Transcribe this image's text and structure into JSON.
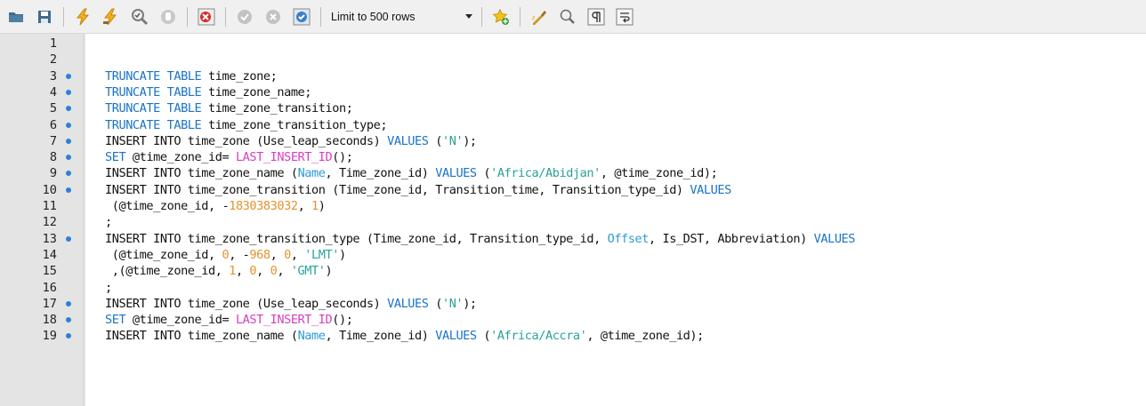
{
  "toolbar": {
    "limit_label": "Limit to 500 rows",
    "buttons": [
      {
        "name": "open-folder-icon"
      },
      {
        "name": "save-icon"
      },
      {
        "name": "execute-icon"
      },
      {
        "name": "execute-current-icon"
      },
      {
        "name": "explain-icon"
      },
      {
        "name": "stop-icon"
      },
      {
        "name": "toggle-error-icon"
      },
      {
        "name": "commit-icon"
      },
      {
        "name": "rollback-icon"
      },
      {
        "name": "autocommit-icon"
      },
      {
        "name": "add-snippet-icon"
      },
      {
        "name": "beautify-icon"
      },
      {
        "name": "find-icon"
      },
      {
        "name": "invisible-chars-icon"
      },
      {
        "name": "wrap-icon"
      }
    ]
  },
  "editor": {
    "lines": [
      {
        "n": "1",
        "dot": false,
        "tokens": []
      },
      {
        "n": "2",
        "dot": false,
        "tokens": []
      },
      {
        "n": "3",
        "dot": true,
        "tokens": [
          [
            "kw",
            "TRUNCATE TABLE"
          ],
          [
            "t",
            " time_zone;"
          ]
        ]
      },
      {
        "n": "4",
        "dot": true,
        "tokens": [
          [
            "kw",
            "TRUNCATE TABLE"
          ],
          [
            "t",
            " time_zone_name;"
          ]
        ]
      },
      {
        "n": "5",
        "dot": true,
        "tokens": [
          [
            "kw",
            "TRUNCATE TABLE"
          ],
          [
            "t",
            " time_zone_transition;"
          ]
        ]
      },
      {
        "n": "6",
        "dot": true,
        "tokens": [
          [
            "kw",
            "TRUNCATE TABLE"
          ],
          [
            "t",
            " time_zone_transition_type;"
          ]
        ]
      },
      {
        "n": "7",
        "dot": true,
        "tokens": [
          [
            "t",
            "INSERT INTO time_zone (Use_leap_seconds) "
          ],
          [
            "kw",
            "VALUES"
          ],
          [
            "t",
            " ("
          ],
          [
            "str",
            "'N'"
          ],
          [
            "t",
            ");"
          ]
        ]
      },
      {
        "n": "8",
        "dot": true,
        "tokens": [
          [
            "kw",
            "SET"
          ],
          [
            "t",
            " @time_zone_id= "
          ],
          [
            "fn",
            "LAST_INSERT_ID"
          ],
          [
            "t",
            "();"
          ]
        ]
      },
      {
        "n": "9",
        "dot": true,
        "tokens": [
          [
            "t",
            "INSERT INTO time_zone_name ("
          ],
          [
            "col",
            "Name"
          ],
          [
            "t",
            ", Time_zone_id) "
          ],
          [
            "kw",
            "VALUES"
          ],
          [
            "t",
            " ("
          ],
          [
            "str",
            "'Africa/Abidjan'"
          ],
          [
            "t",
            ", @time_zone_id);"
          ]
        ]
      },
      {
        "n": "10",
        "dot": true,
        "tokens": [
          [
            "t",
            "INSERT INTO time_zone_transition (Time_zone_id, Transition_time, Transition_type_id) "
          ],
          [
            "kw",
            "VALUES"
          ]
        ]
      },
      {
        "n": "11",
        "dot": false,
        "tokens": [
          [
            "t",
            " (@time_zone_id, -"
          ],
          [
            "num",
            "1830383032"
          ],
          [
            "t",
            ", "
          ],
          [
            "num",
            "1"
          ],
          [
            "t",
            ")"
          ]
        ]
      },
      {
        "n": "12",
        "dot": false,
        "tokens": [
          [
            "t",
            ";"
          ]
        ]
      },
      {
        "n": "13",
        "dot": true,
        "tokens": [
          [
            "t",
            "INSERT INTO time_zone_transition_type (Time_zone_id, Transition_type_id, "
          ],
          [
            "col",
            "Offset"
          ],
          [
            "t",
            ", Is_DST, Abbreviation) "
          ],
          [
            "kw",
            "VALUES"
          ]
        ]
      },
      {
        "n": "14",
        "dot": false,
        "tokens": [
          [
            "t",
            " (@time_zone_id, "
          ],
          [
            "num",
            "0"
          ],
          [
            "t",
            ", -"
          ],
          [
            "num",
            "968"
          ],
          [
            "t",
            ", "
          ],
          [
            "num",
            "0"
          ],
          [
            "t",
            ", "
          ],
          [
            "str",
            "'LMT'"
          ],
          [
            "t",
            ")"
          ]
        ]
      },
      {
        "n": "15",
        "dot": false,
        "tokens": [
          [
            "t",
            " ,(@time_zone_id, "
          ],
          [
            "num",
            "1"
          ],
          [
            "t",
            ", "
          ],
          [
            "num",
            "0"
          ],
          [
            "t",
            ", "
          ],
          [
            "num",
            "0"
          ],
          [
            "t",
            ", "
          ],
          [
            "str",
            "'GMT'"
          ],
          [
            "t",
            ")"
          ]
        ]
      },
      {
        "n": "16",
        "dot": false,
        "tokens": [
          [
            "t",
            ";"
          ]
        ]
      },
      {
        "n": "17",
        "dot": true,
        "tokens": [
          [
            "t",
            "INSERT INTO time_zone (Use_leap_seconds) "
          ],
          [
            "kw",
            "VALUES"
          ],
          [
            "t",
            " ("
          ],
          [
            "str",
            "'N'"
          ],
          [
            "t",
            ");"
          ]
        ]
      },
      {
        "n": "18",
        "dot": true,
        "tokens": [
          [
            "kw",
            "SET"
          ],
          [
            "t",
            " @time_zone_id= "
          ],
          [
            "fn",
            "LAST_INSERT_ID"
          ],
          [
            "t",
            "();"
          ]
        ]
      },
      {
        "n": "19",
        "dot": true,
        "tokens": [
          [
            "t",
            "INSERT INTO time_zone_name ("
          ],
          [
            "col",
            "Name"
          ],
          [
            "t",
            ", Time_zone_id) "
          ],
          [
            "kw",
            "VALUES"
          ],
          [
            "t",
            " ("
          ],
          [
            "str",
            "'Africa/Accra'"
          ],
          [
            "t",
            ", @time_zone_id);"
          ]
        ]
      }
    ]
  }
}
